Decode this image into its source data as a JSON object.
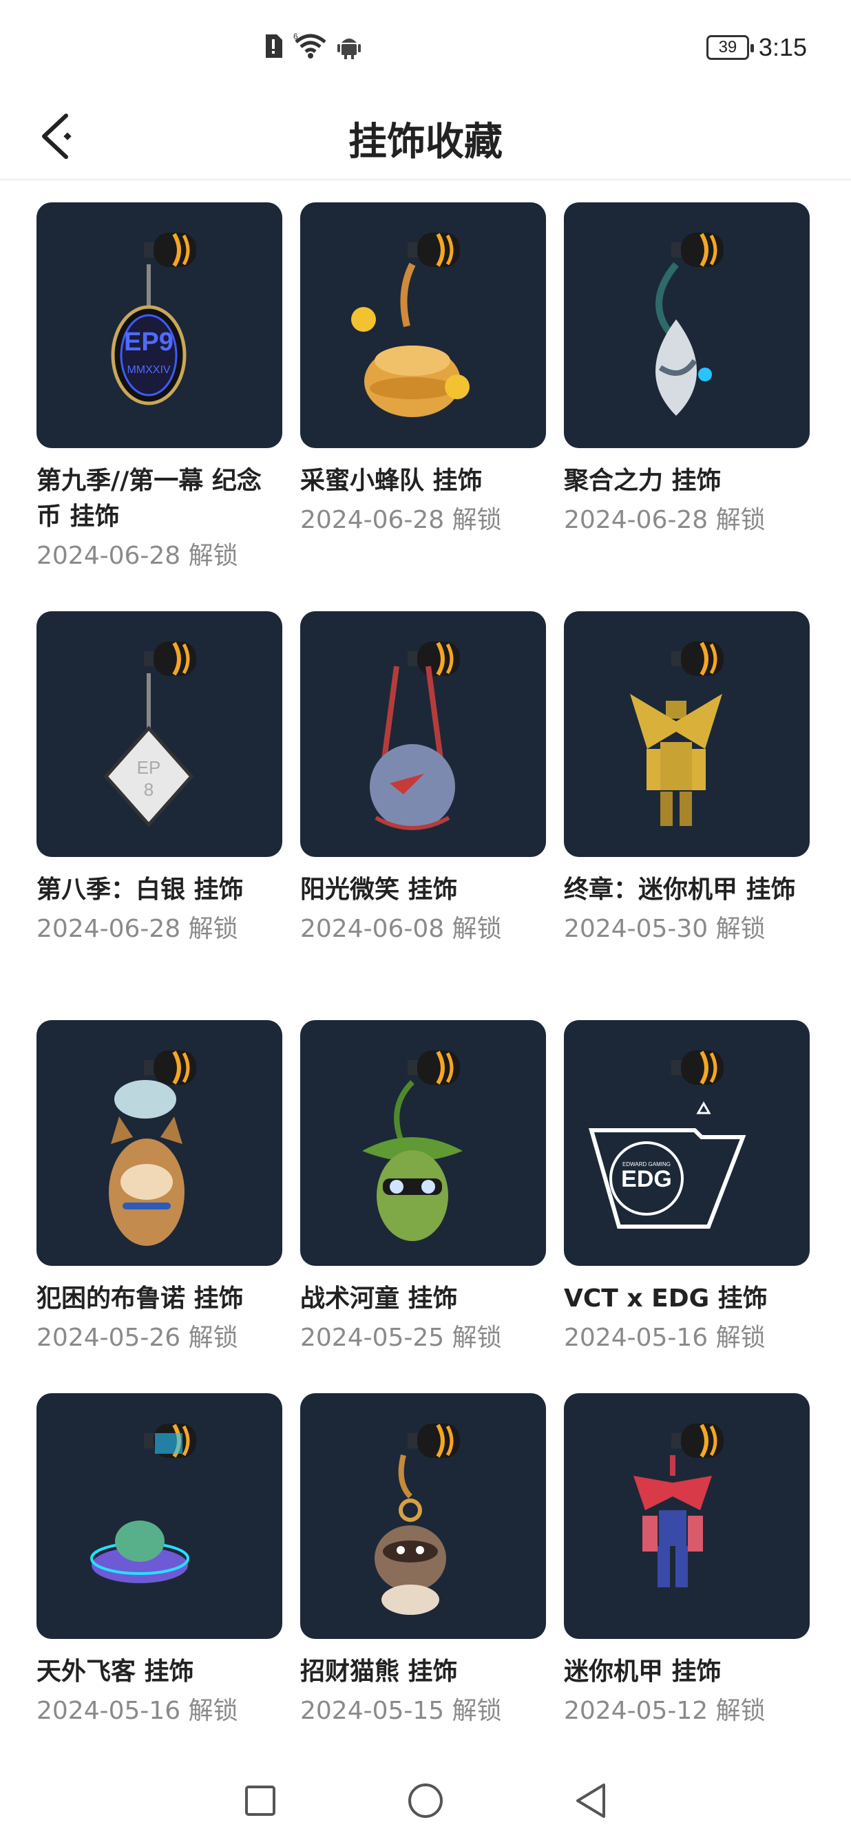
{
  "status_bar": {
    "battery": "39",
    "time": "3:15"
  },
  "header": {
    "title": "挂饰收藏"
  },
  "items": [
    {
      "name": "第九季//第一幕 纪念币 挂饰",
      "date": "2024-06-28 解锁",
      "art": "ep9-coin"
    },
    {
      "name": "采蜜小蜂队 挂饰",
      "date": "2024-06-28 解锁",
      "art": "beehive"
    },
    {
      "name": "聚合之力 挂饰",
      "date": "2024-06-28 解锁",
      "art": "drop"
    },
    {
      "name": "第八季：白银 挂饰",
      "date": "2024-06-28 解锁",
      "art": "ep8-diamond"
    },
    {
      "name": "阳光微笑 挂饰",
      "date": "2024-06-08 解锁",
      "art": "ball"
    },
    {
      "name": "终章：迷你机甲 挂饰",
      "date": "2024-05-30 解锁",
      "art": "gold-robot"
    },
    {
      "name": "犯困的布鲁诺 挂饰",
      "date": "2024-05-26 解锁",
      "art": "dog"
    },
    {
      "name": "战术河童 挂饰",
      "date": "2024-05-25 解锁",
      "art": "kappa"
    },
    {
      "name": "VCT x EDG 挂饰",
      "date": "2024-05-16 解锁",
      "art": "edg"
    },
    {
      "name": "天外飞客 挂饰",
      "date": "2024-05-16 解锁",
      "art": "ufo"
    },
    {
      "name": "招财猫熊 挂饰",
      "date": "2024-05-15 解锁",
      "art": "raccoon"
    },
    {
      "name": "迷你机甲 挂饰",
      "date": "2024-05-12 解锁",
      "art": "robot"
    }
  ],
  "icons": {
    "status": [
      "sim-alert-icon",
      "wifi-icon",
      "android-icon"
    ],
    "nav": [
      "recent-apps-icon",
      "home-icon",
      "back-nav-icon"
    ]
  },
  "colors": {
    "thumb_bg": "#1c2838",
    "accent": "#f5a623",
    "title": "#222222",
    "date": "#8a8a8a"
  }
}
